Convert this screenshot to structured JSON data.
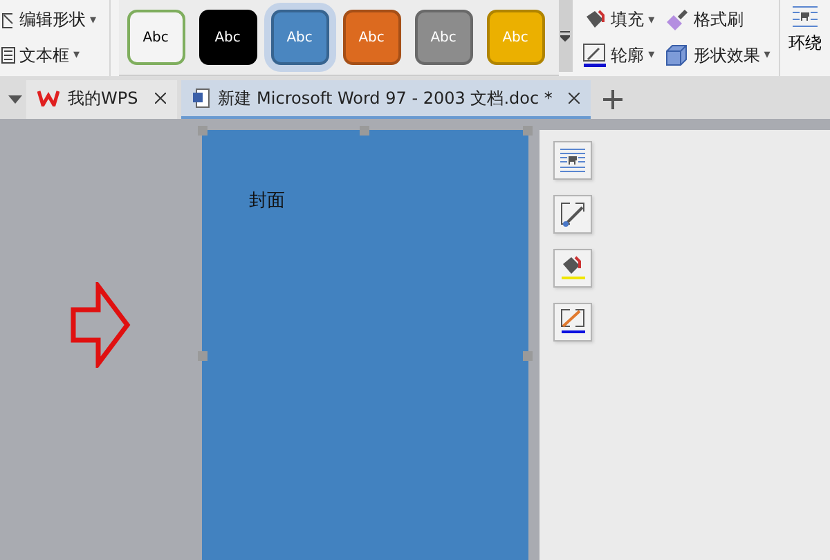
{
  "ribbon": {
    "shape_tools": [
      {
        "label": "编辑形状",
        "caret": "▾"
      },
      {
        "label": "文本框",
        "caret": "▾"
      }
    ],
    "styles": [
      {
        "label": "Abc",
        "color": "#f4f4f4",
        "selected": false
      },
      {
        "label": "Abc",
        "color": "#000000",
        "selected": false
      },
      {
        "label": "Abc",
        "color": "#4a86c0",
        "selected": true
      },
      {
        "label": "Abc",
        "color": "#dc6a1f",
        "selected": false
      },
      {
        "label": "Abc",
        "color": "#8c8c8c",
        "selected": false
      },
      {
        "label": "Abc",
        "color": "#ebb000",
        "selected": false
      }
    ],
    "format_tools": [
      {
        "kind": "fill",
        "label": "填充",
        "caret": "▾"
      },
      {
        "kind": "brush",
        "label": "格式刷"
      },
      {
        "kind": "outline",
        "label": "轮廓",
        "caret": "▾"
      },
      {
        "kind": "effect",
        "label": "形状效果",
        "caret": "▾"
      }
    ],
    "wrap": {
      "label": "环绕"
    }
  },
  "tabs": [
    {
      "kind": "home",
      "label": "我的WPS",
      "selected": false
    },
    {
      "kind": "doc",
      "label": "新建 Microsoft Word 97 - 2003 文档.doc *",
      "selected": true
    }
  ],
  "page": {
    "text": "封面"
  },
  "side_tools": [
    {
      "kind": "wrap"
    },
    {
      "kind": "edit"
    },
    {
      "kind": "fill"
    },
    {
      "kind": "outline"
    }
  ]
}
